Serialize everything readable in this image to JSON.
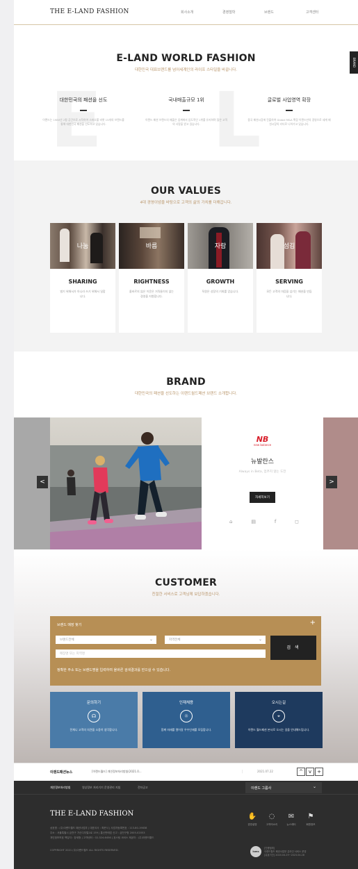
{
  "header": {
    "logo": "THE E-LAND FASHION",
    "nav": [
      "회사소개",
      "경영철학",
      "브랜드",
      "고객센터"
    ]
  },
  "side_tab": "BRAND",
  "about": {
    "title": "E-LAND WORLD FASHION",
    "subtitle": "대한민국 대표브랜드를 넘어세계인의 라이프 스타일을 바꿉니다.",
    "bg_letters": "E L G",
    "features": [
      {
        "title": "대한민국의 패션을 선도",
        "desc": "이랜드는 1980년 2평 공간으로 시작하여 스파오를 비롯 15개의 브랜드를 통해 대한민국 패션을 선도하고 있습니다."
      },
      {
        "title": "국내매출규모 1위",
        "desc": "이랜드 패션 브랜드의 매출은 업계에서 압도적인 1위를 유지하며 많은 고객의 사랑을 받고 있습니다."
      },
      {
        "title": "글로벌 사업영역 확장",
        "desc": "중국 패션시장에 진출하여 Global M&A 확장 이랜드만의 경영으로 세계 패션시장의 리더로 나아가고 있습니다."
      }
    ]
  },
  "values": {
    "title": "OUR VALUES",
    "subtitle": "4대 경영이념을 바탕으로 고객의 삶의 가치를 더해갑니다.",
    "cards": [
      {
        "ko": "나눔",
        "en": "SHARING",
        "desc": "벌기 위해서가 아니라 쓰기 위해서 일합니다."
      },
      {
        "ko": "바름",
        "en": "RIGHTNESS",
        "desc": "올바르지 않은 이윤은 거둬들이지 않는 경영을 지향합니다."
      },
      {
        "ko": "자람",
        "en": "GROWTH",
        "desc": "직원은 성장의 기회를 얻습니다."
      },
      {
        "ko": "섬김",
        "en": "SERVING",
        "desc": "모든 고객의 마음을 섬기는 패션을 만듭니다."
      }
    ]
  },
  "brand": {
    "title": "BRAND",
    "subtitle": "대한민국의 패션을 선도하는 이랜드월드패션 브랜드 소개합니다.",
    "logo_mark": "NB",
    "logo_sub": "new balance",
    "name": "뉴발란스",
    "slogan": "Always in Beta, 멈추지 않는 도전",
    "more_label": "자세히보기",
    "prev": "<",
    "next": ">",
    "icons": [
      "home-icon",
      "store-icon",
      "facebook-icon",
      "instagram-icon"
    ]
  },
  "customer": {
    "title": "CUSTOMER",
    "subtitle": "친절한 서비스로 고객님께 보답하겠습니다.",
    "finder": {
      "title": "브랜드 매장 찾기",
      "plus": "+",
      "select1": "브랜드전체",
      "select2": "지역전체",
      "input_placeholder": "매장명 또는 지역명",
      "button": "검 색",
      "note": "정확한 주소 또는 브랜드명을 입력하여 올바른 검색결과를 얻으실 수 있습니다."
    },
    "boxes": [
      {
        "title": "문의하기",
        "desc": "전체니 고객의 의견을 소중히 생각합니다.",
        "color": "#4a7ba8"
      },
      {
        "title": "인재채용",
        "desc": "함께 미래를 열어갈 우수인재를 모집합니다.",
        "color": "#2f5f8f"
      },
      {
        "title": "오시는길",
        "desc": "이랜드 월드패션 본사로 오시는 길을 안내해드립니다.",
        "color": "#1e3a5e"
      }
    ]
  },
  "news": {
    "title": "이랜드패션뉴스",
    "text": "[이랜드월드] 개인정보처리방침(2021.0...",
    "sep": "|",
    "date": "2021.07.22",
    "buttons": [
      "^",
      "v",
      "+"
    ]
  },
  "footer": {
    "links": [
      "개인정보처리방침",
      "영상정보 처리기기 운영관리 지침",
      "전자공고"
    ],
    "group": "이랜드 그룹사",
    "logo": "THE E-LAND FASHION",
    "info1": "상호명 : (주)이랜드월드 패션사업부 | 대표이사 : 최운식 | 사업자등록번호 : 113-80-19838",
    "info2": "주소 : 서울특별시 금천구 가산디지털1로 159 | 통신판매업 신고 : 금천구청 2005-02053",
    "info3": "개인정보보호 책임자 : 장세형 | 고객센터 : 02-324-6456 | 호스팅 서비스 제공자 : (주)이랜드월드",
    "copyright": "COPYRIGHT 2021 (주)이랜드월드 ALL RIGHTS RESERVED.",
    "icons": [
      {
        "label": "경영설명",
        "glyph": "✋"
      },
      {
        "label": "고객의소리",
        "glyph": "◌"
      },
      {
        "label": "뉴스레터",
        "glyph": "✉"
      },
      {
        "label": "회원정보",
        "glyph": "⚑"
      }
    ],
    "isms_badge": "isms",
    "isms_text": "[인증범위]\n이랜드월드 패션사업부 온라인 서비스 운영\n[유효기간] 2020.04.29~2023.04.28"
  }
}
